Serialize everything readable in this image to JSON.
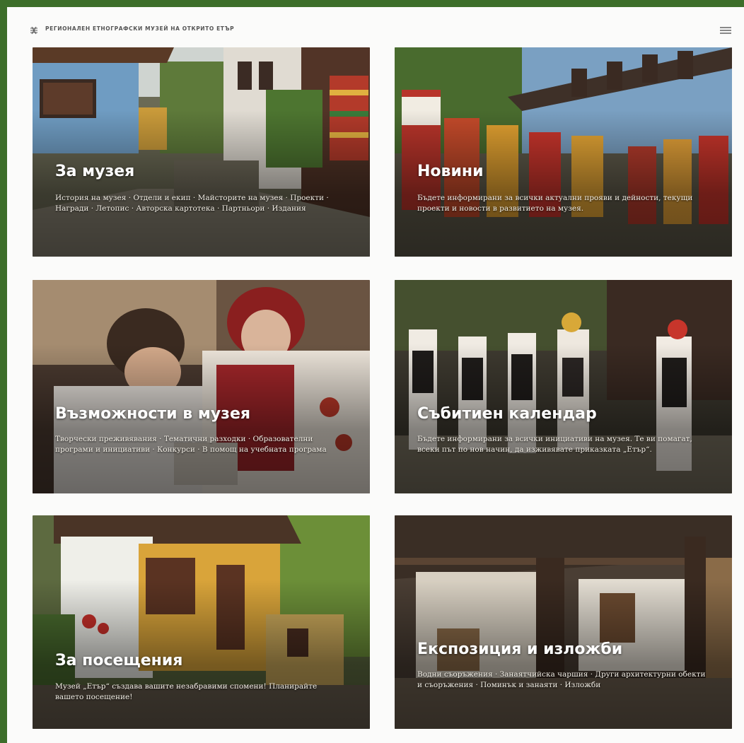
{
  "header": {
    "site_title": "РЕГИОНАЛЕН ЕТНОГРАФСКИ МУЗЕЙ НА ОТКРИТО ЕТЪР",
    "logo_icon": "museum-logo-icon",
    "menu_icon": "hamburger-menu-icon"
  },
  "cards": [
    {
      "title": "За музея",
      "description": "История на музея · Отдели и екип · Майсторите на музея · Проекти · Награди · Летопис · Авторска картотека · Партньори · Издания"
    },
    {
      "title": "Новини",
      "description": "Бъдете информирани за всички актуални прояви и дейности, текущи проекти и новости в развитието на музея."
    },
    {
      "title": "Възможности в музея",
      "description": "Творчески преживявания · Тематични разходки · Образователни програми и инициативи · Конкурси · В помощ на учебната програма"
    },
    {
      "title": "Събитиен календар",
      "description": "Бъдете информирани за всички инициативи на музея. Те ви помагат, всеки път по нов начин, да изживявате приказката „Етър“."
    },
    {
      "title": "За посещения",
      "description": "Музей „Етър“ създава вашите незабравими спомени! Планирайте вашето посещение!"
    },
    {
      "title": "Експозиция и изложби",
      "description": "Водни съоръжения · Занаятчийска чаршия · Други архитектурни обекти и съоръжения · Поминък и занаяти · Изложби"
    }
  ],
  "colors": {
    "frame_green": "#3d6e2a",
    "page_background": "#fbfbfa",
    "title_white": "#ffffff"
  }
}
